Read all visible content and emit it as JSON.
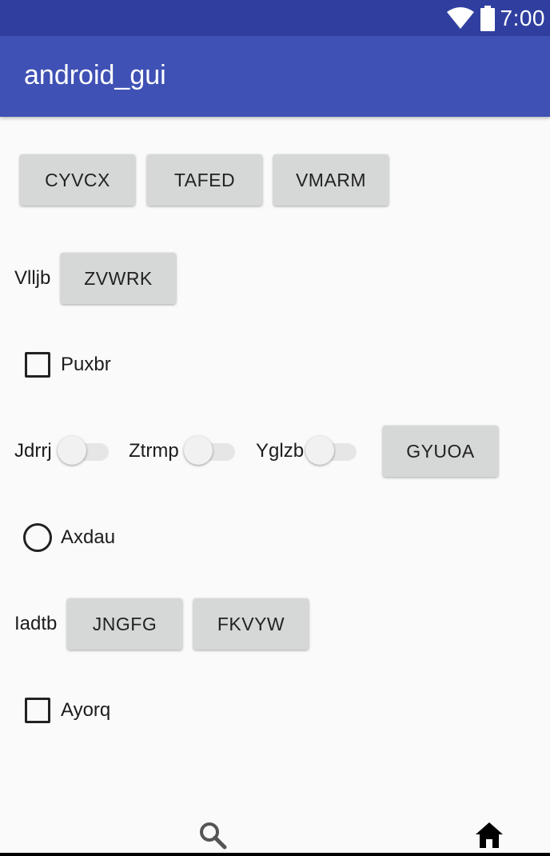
{
  "status_bar": {
    "time": "7:00",
    "wifi_icon": "wifi-icon",
    "battery_icon": "battery-icon"
  },
  "app_bar": {
    "title": "android_gui"
  },
  "row1": {
    "buttons": [
      "CYVCX",
      "TAFED",
      "VMARM"
    ]
  },
  "row2": {
    "label": "Vlljb",
    "button": "ZVWRK"
  },
  "row3": {
    "checkbox_label": "Puxbr",
    "checked": false
  },
  "row4": {
    "switches": [
      {
        "label": "Jdrrj",
        "on": false
      },
      {
        "label": "Ztrmp",
        "on": false
      },
      {
        "label": "Yglzb",
        "on": false
      }
    ],
    "button": "GYUOA"
  },
  "row5": {
    "radio_label": "Axdau",
    "selected": false
  },
  "row6": {
    "label": "Iadtb",
    "buttons": [
      "JNGFG",
      "FKVYW"
    ]
  },
  "row7": {
    "checkbox_label": "Ayorq",
    "checked": false
  },
  "bottom_nav": {
    "search_icon": "search-icon",
    "home_icon": "home-icon"
  }
}
